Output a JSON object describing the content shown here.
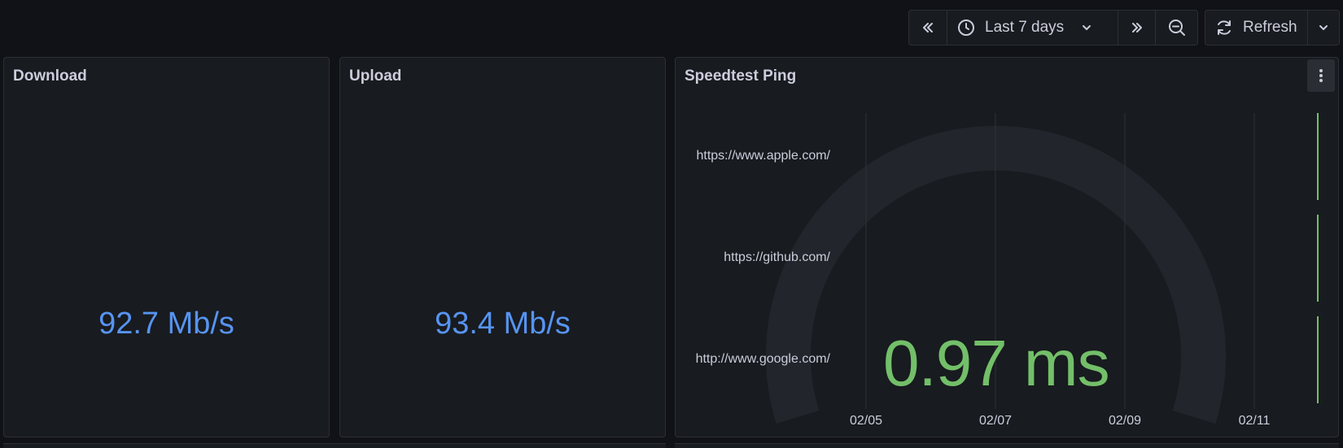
{
  "toolbar": {
    "time_range_label": "Last 7 days",
    "refresh_label": "Refresh"
  },
  "panels": {
    "download": {
      "title": "Download",
      "value": "92.7 Mb/s"
    },
    "upload": {
      "title": "Upload",
      "value": "93.4 Mb/s"
    },
    "ping": {
      "title": "Speedtest Ping",
      "value": "0.97 ms",
      "rows": [
        "https://www.apple.com/",
        "https://github.com/",
        "http://www.google.com/"
      ],
      "x_ticks": [
        "02/05",
        "02/07",
        "02/09",
        "02/11"
      ]
    }
  },
  "colors": {
    "background": "#111217",
    "panel": "#181b1f",
    "stat_blue": "#5794f2",
    "ok_green": "#73bf69",
    "gauge_track": "#22252b"
  }
}
